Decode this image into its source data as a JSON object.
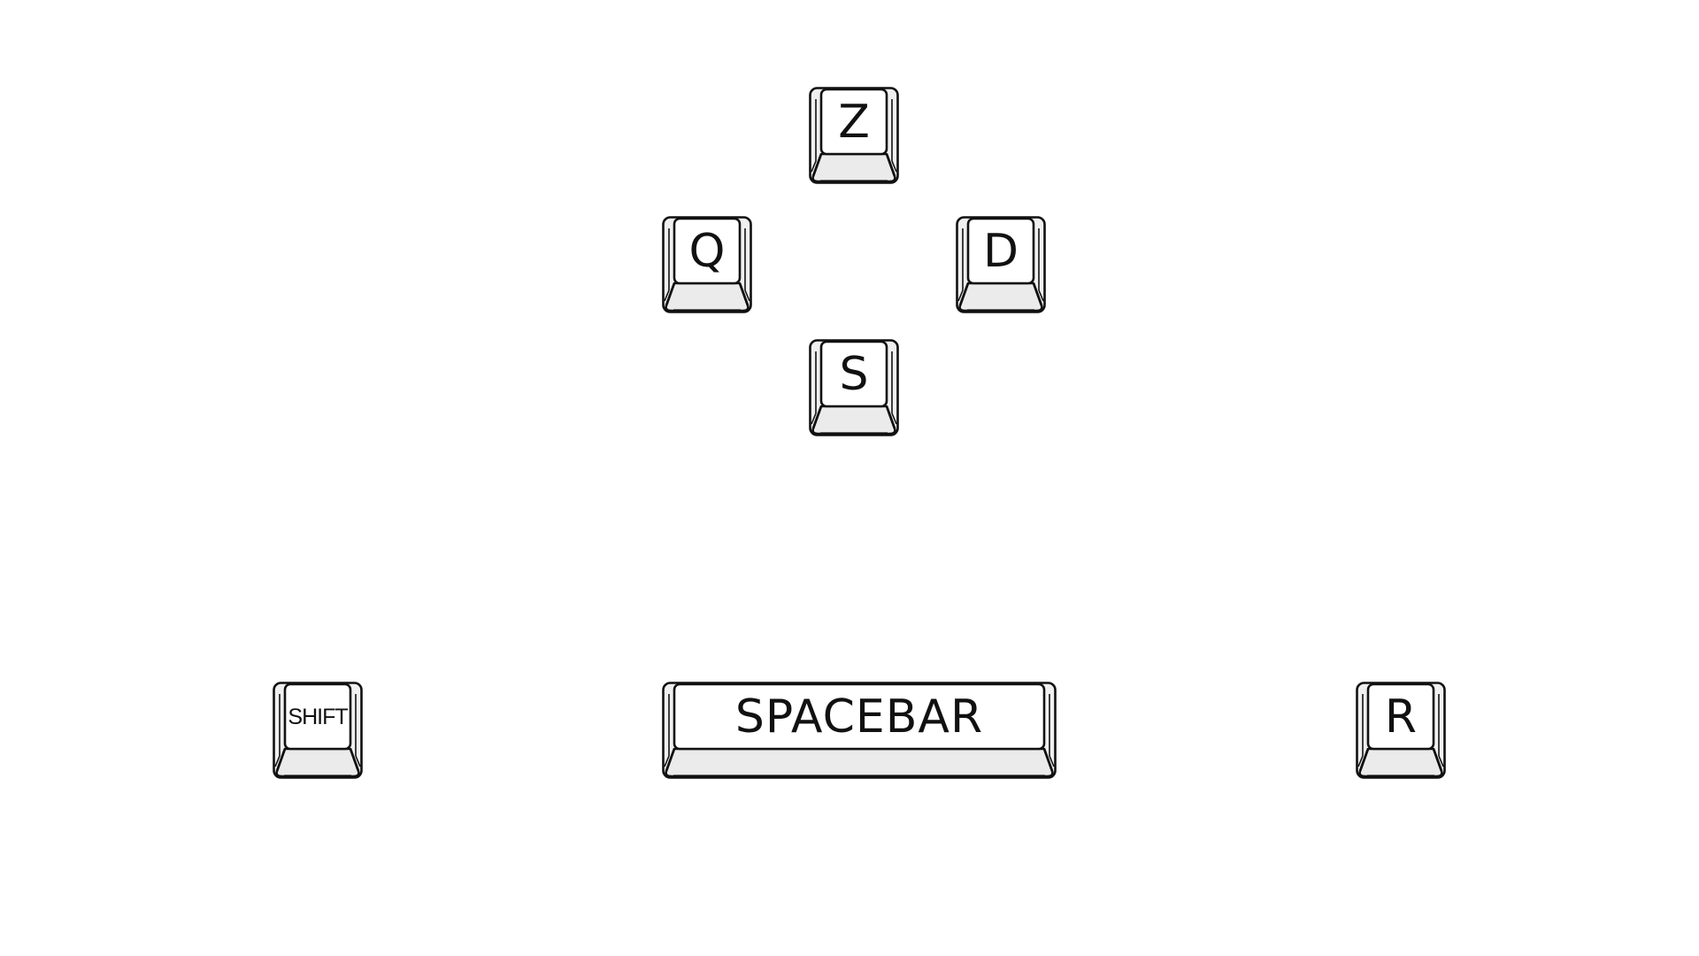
{
  "keys": {
    "z": {
      "label": "Z"
    },
    "q": {
      "label": "Q"
    },
    "d": {
      "label": "D"
    },
    "s": {
      "label": "S"
    },
    "shift": {
      "label": "SHIFT"
    },
    "spacebar": {
      "label": "SPACEBAR"
    },
    "r": {
      "label": "R"
    }
  },
  "colors": {
    "outline": "#111111",
    "keycap_top": "#ffffff",
    "keycap_side": "#f0f0f0",
    "keycap_front": "#ebebeb"
  }
}
